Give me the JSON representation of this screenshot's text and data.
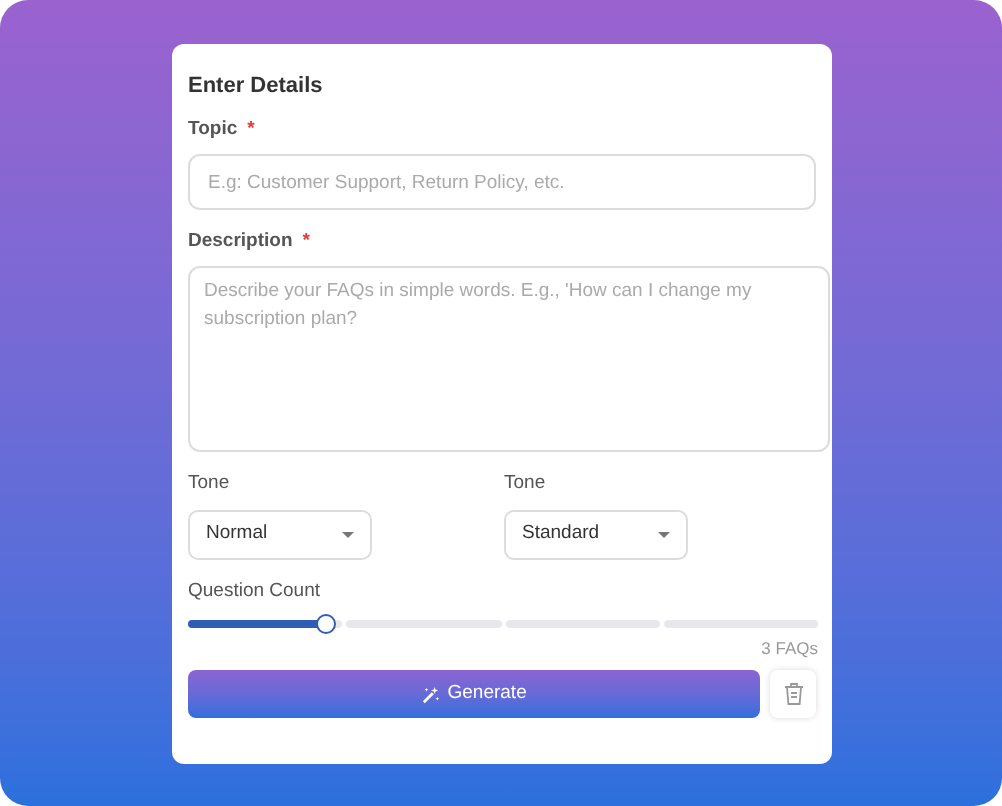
{
  "title": "Enter Details",
  "topic": {
    "label": "Topic",
    "required_mark": "*",
    "placeholder": "E.g: Customer Support, Return Policy, etc."
  },
  "description": {
    "label": "Description",
    "required_mark": "*",
    "placeholder": "Describe your FAQs in simple words. E.g., 'How can I change my subscription plan?"
  },
  "selects": [
    {
      "label": "Tone",
      "value": "Normal"
    },
    {
      "label": "Tone",
      "value": "Standard"
    }
  ],
  "question_count": {
    "label": "Question Count",
    "level": 0.22,
    "reading": "3 FAQs"
  },
  "generate_button": {
    "label": "Generate"
  }
}
